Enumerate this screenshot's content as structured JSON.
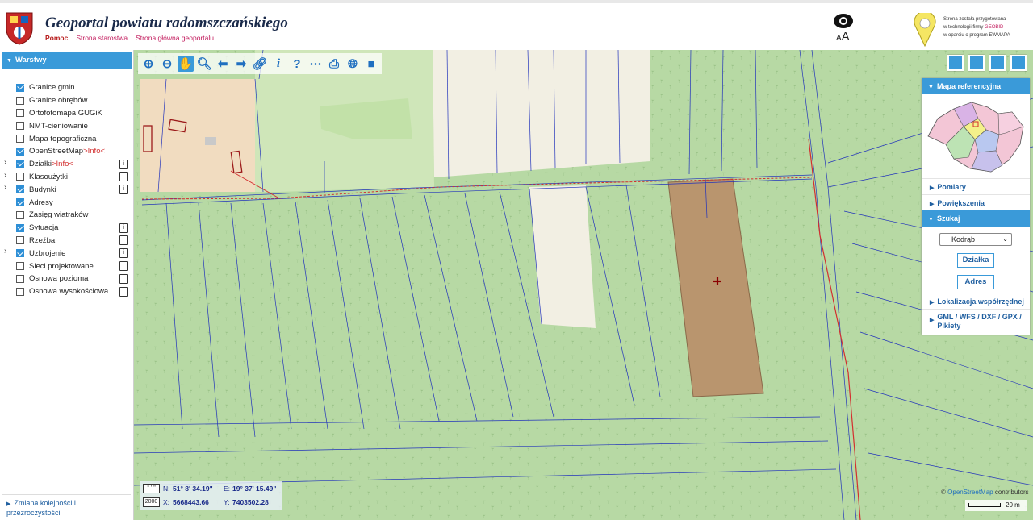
{
  "header": {
    "title": "Geoportal powiatu radomszczańskiego",
    "links": [
      "Pomoc",
      "Strona starostwa",
      "Strona główna geoportalu"
    ],
    "font_size_control": "AA",
    "geobid_text": [
      "Strona została przygotowana",
      "w technologii firmy GEOBID",
      "w oparciu o program EWMAPA"
    ],
    "geobid_word": "GEOBID"
  },
  "sidebar": {
    "panel_title": "Warstwy",
    "layers": [
      {
        "label": "Granice gmin",
        "checked": true,
        "expandable": false,
        "doc": false
      },
      {
        "label": "Granice obrębów",
        "checked": false,
        "expandable": false,
        "doc": false
      },
      {
        "label": "Ortofotomapa GUGiK",
        "checked": false,
        "expandable": false,
        "doc": false
      },
      {
        "label": "NMT-cieniowanie",
        "checked": false,
        "expandable": false,
        "doc": false
      },
      {
        "label": "Mapa topograficzna",
        "checked": false,
        "expandable": false,
        "doc": false
      },
      {
        "label": "OpenStreetMap",
        "info": ">Info<",
        "checked": true,
        "expandable": false,
        "doc": false
      },
      {
        "label": "Działki",
        "info": ">Info<",
        "checked": true,
        "expandable": true,
        "doc": "info"
      },
      {
        "label": "Klasoużytki",
        "checked": false,
        "expandable": true,
        "doc": "empty"
      },
      {
        "label": "Budynki",
        "checked": true,
        "expandable": true,
        "doc": "info"
      },
      {
        "label": "Adresy",
        "checked": true,
        "expandable": false,
        "doc": false
      },
      {
        "label": "Zasięg wiatraków",
        "checked": false,
        "expandable": false,
        "doc": false
      },
      {
        "label": "Sytuacja",
        "checked": true,
        "expandable": false,
        "doc": "info"
      },
      {
        "label": "Rzeźba",
        "checked": false,
        "expandable": false,
        "doc": "empty"
      },
      {
        "label": "Uzbrojenie",
        "checked": true,
        "expandable": true,
        "doc": "info"
      },
      {
        "label": "Sieci projektowane",
        "checked": false,
        "expandable": false,
        "doc": "empty"
      },
      {
        "label": "Osnowa pozioma",
        "checked": false,
        "expandable": false,
        "doc": "empty"
      },
      {
        "label": "Osnowa wysokościowa",
        "checked": false,
        "expandable": false,
        "doc": "empty"
      }
    ],
    "order_link": "Zmiana kolejności i przezroczystości"
  },
  "toolbar": {
    "tools": [
      "zoom-in-icon",
      "zoom-out-icon",
      "pan-hand-icon",
      "zoom-box-icon",
      "back-icon",
      "forward-icon",
      "link-icon",
      "info-icon",
      "query-icon",
      "measure-icon",
      "print-icon",
      "globe-icon",
      "streetview-icon"
    ],
    "active": "pan-hand-icon"
  },
  "right_panel": {
    "ref_map_title": "Mapa referencyjna",
    "items": [
      "Pomiary",
      "Powiększenia"
    ],
    "search_title": "Szukaj",
    "town_selected": "Kodrąb",
    "search_buttons": [
      "Działka",
      "Adres"
    ],
    "coord_loc": "Lokalizacja współrzędnej",
    "gml": "GML / WFS / DXF / GPX / Pikiety"
  },
  "coords": {
    "unit_dms": "° ' \"",
    "unit_2000": "2000",
    "n_label": "N:",
    "n_value": "51° 8' 34.19\"",
    "e_label": "E:",
    "e_value": "19° 37' 15.49\"",
    "x_label": "X:",
    "x_value": "5668443.66",
    "y_label": "Y:",
    "y_value": "7403502.28"
  },
  "map": {
    "attribution_prefix": "©",
    "attribution_osm": "OpenStreetMap",
    "attribution_suffix": "contributors",
    "scale_label": "20 m",
    "colors": {
      "accent": "#3a9ad9",
      "forest": "#b7d9a4",
      "field": "#f2efe3",
      "parcel": "#b9956e",
      "boundary": "#2233bb",
      "utility": "#d32f2f"
    }
  }
}
